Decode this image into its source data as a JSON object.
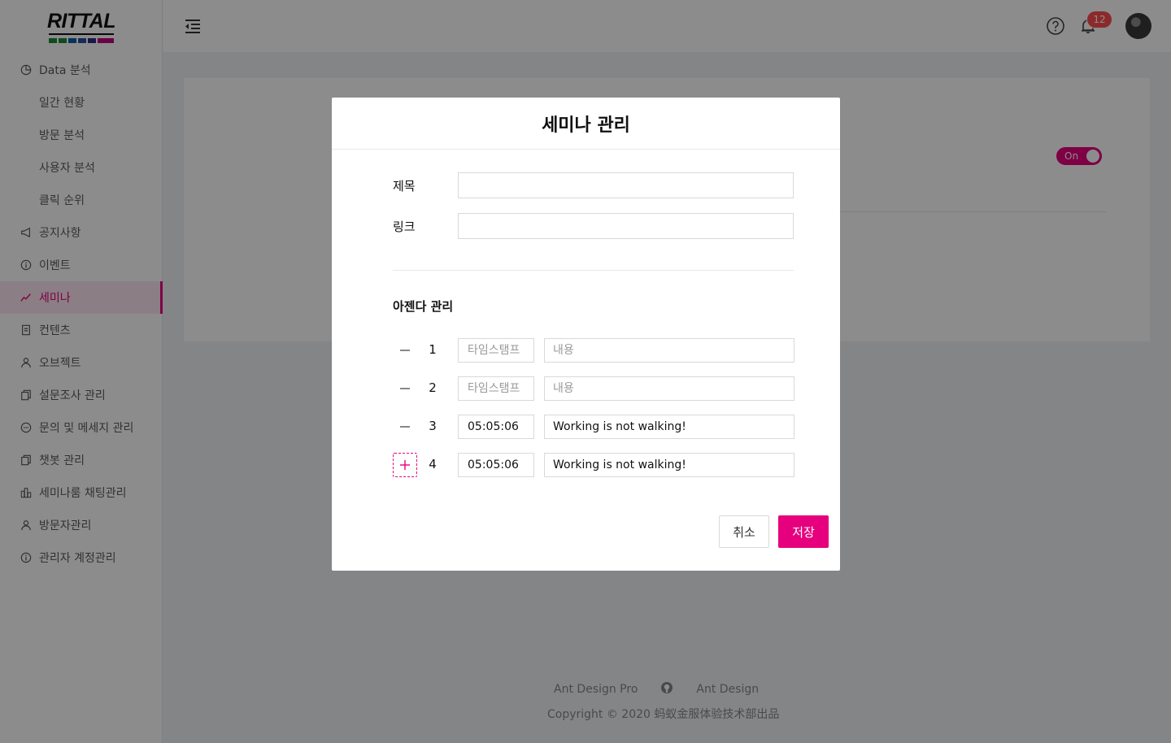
{
  "brand": {
    "logo_text": "RITTAL",
    "logo_bar_colors": [
      "#1b8a3a",
      "#1b8a3a",
      "#0a5ea8",
      "#2a4fa0",
      "#2a2f8a",
      "#c4007a"
    ]
  },
  "sidebar": {
    "items": [
      {
        "label": "Data 분석",
        "icon": "pie-chart-icon",
        "sub": false
      },
      {
        "label": "일간 현황",
        "icon": "",
        "sub": true
      },
      {
        "label": "방문 분석",
        "icon": "",
        "sub": true
      },
      {
        "label": "사용자 분석",
        "icon": "",
        "sub": true
      },
      {
        "label": "클릭 순위",
        "icon": "",
        "sub": true
      },
      {
        "label": "공지사항",
        "icon": "megaphone-icon",
        "sub": false
      },
      {
        "label": "이벤트",
        "icon": "info-circle-icon",
        "sub": false
      },
      {
        "label": "세미나",
        "icon": "line-chart-icon",
        "sub": false,
        "active": true
      },
      {
        "label": "컨텐츠",
        "icon": "file-icon",
        "sub": false
      },
      {
        "label": "오브젝트",
        "icon": "user-icon",
        "sub": false
      },
      {
        "label": "설문조사 관리",
        "icon": "copy-icon",
        "sub": false
      },
      {
        "label": "문의 및 메세지 관리",
        "icon": "message-icon",
        "sub": false
      },
      {
        "label": "챗봇 관리",
        "icon": "copy-icon",
        "sub": false
      },
      {
        "label": "세미나룸 채팅관리",
        "icon": "chat-room-icon",
        "sub": false
      },
      {
        "label": "방문자관리",
        "icon": "user-icon",
        "sub": false
      },
      {
        "label": "관리자 계정관리",
        "icon": "info-circle-icon",
        "sub": false
      }
    ]
  },
  "header": {
    "notification_count": "12",
    "help_icon": "question-circle-icon",
    "bell_icon": "bell-icon"
  },
  "background": {
    "toggle_label": "On"
  },
  "footer": {
    "link1": "Ant Design Pro",
    "link2": "Ant Design",
    "copyright": "Copyright © 2020 蚂蚁金服体验技术部出品"
  },
  "modal": {
    "title": "세미나 관리",
    "title_label": "제목",
    "title_value": "",
    "link_label": "링크",
    "link_value": "",
    "agenda_title": "아젠다 관리",
    "timestamp_placeholder": "타임스탬프",
    "content_placeholder": "내용",
    "rows": [
      {
        "num": "1",
        "action": "remove",
        "timestamp": "",
        "content": ""
      },
      {
        "num": "2",
        "action": "remove",
        "timestamp": "",
        "content": ""
      },
      {
        "num": "3",
        "action": "remove",
        "timestamp": "05:05:06",
        "content": "Working is not walking!"
      },
      {
        "num": "4",
        "action": "add",
        "timestamp": "05:05:06",
        "content": "Working is not walking!"
      }
    ],
    "cancel_label": "취소",
    "save_label": "저장"
  },
  "colors": {
    "accent": "#e6007e",
    "badge": "#ff4d4f"
  }
}
